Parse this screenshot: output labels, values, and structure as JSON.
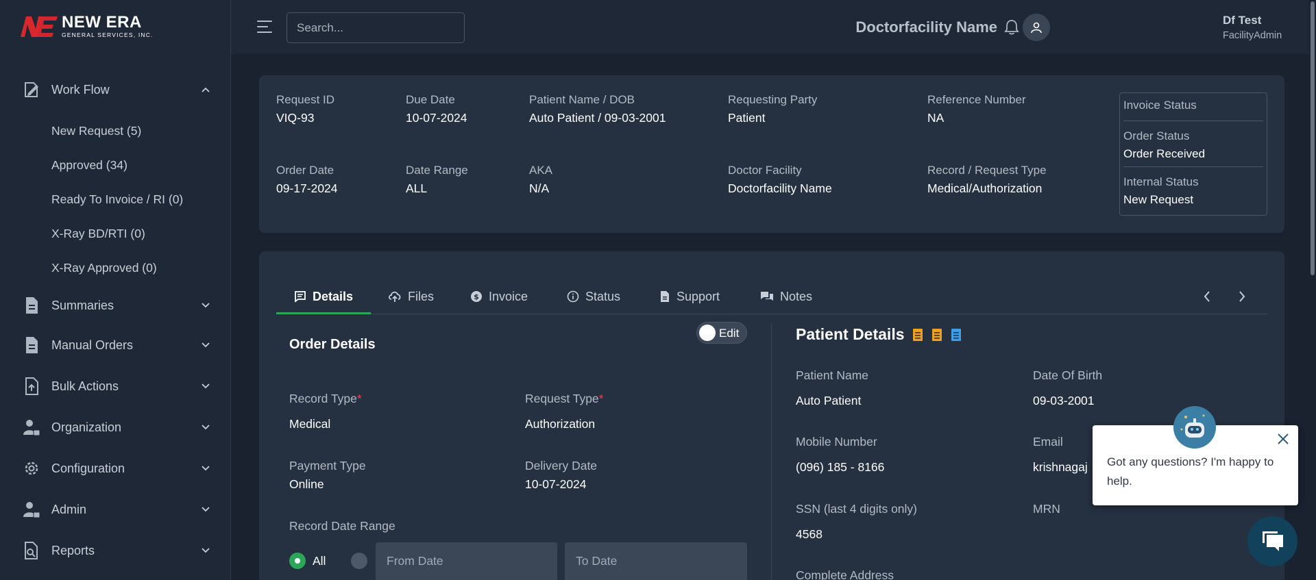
{
  "brand": {
    "mark": "NE",
    "title": "NEW ERA",
    "subtitle": "GENERAL SERVICES, INC."
  },
  "sidebar": {
    "groups": [
      {
        "label": "Work Flow",
        "icon": "workflow-icon",
        "expanded": true,
        "items": [
          "New Request (5)",
          "Approved (34)",
          "Ready To Invoice / RI (0)",
          "X-Ray BD/RTI (0)",
          "X-Ray Approved (0)"
        ]
      },
      {
        "label": "Summaries",
        "icon": "document-icon",
        "expanded": false
      },
      {
        "label": "Manual Orders",
        "icon": "document-icon",
        "expanded": false
      },
      {
        "label": "Bulk Actions",
        "icon": "upload-file-icon",
        "expanded": false
      },
      {
        "label": "Organization",
        "icon": "user-lock-icon",
        "expanded": false
      },
      {
        "label": "Configuration",
        "icon": "gear-icon",
        "expanded": false
      },
      {
        "label": "Admin",
        "icon": "user-lock-icon",
        "expanded": false
      },
      {
        "label": "Reports",
        "icon": "report-search-icon",
        "expanded": false
      }
    ]
  },
  "topbar": {
    "search_placeholder": "Search...",
    "facility_name": "Doctorfacility Name",
    "user_name": "Df Test",
    "user_role": "FacilityAdmin"
  },
  "request_info": {
    "request_id": {
      "label": "Request ID",
      "value": "VIQ-93"
    },
    "due_date": {
      "label": "Due Date",
      "value": "10-07-2024"
    },
    "patient": {
      "label": "Patient Name / DOB",
      "value": "Auto Patient / 09-03-2001"
    },
    "requesting_party": {
      "label": "Requesting Party",
      "value": "Patient"
    },
    "reference_number": {
      "label": "Reference Number",
      "value": "NA"
    },
    "order_date": {
      "label": "Order Date",
      "value": "09-17-2024"
    },
    "date_range": {
      "label": "Date Range",
      "value": "ALL"
    },
    "aka": {
      "label": "AKA",
      "value": "N/A"
    },
    "doctor_facility": {
      "label": "Doctor Facility",
      "value": "Doctorfacility Name"
    },
    "record_request_type": {
      "label": "Record / Request Type",
      "value": "Medical/Authorization"
    },
    "status_box": {
      "invoice_status_label": "Invoice Status",
      "order_status_label": "Order Status",
      "order_status_value": "Order Received",
      "internal_status_label": "Internal Status",
      "internal_status_value": "New Request"
    }
  },
  "tabs": [
    {
      "label": "Details",
      "icon": "message-square-icon",
      "active": true
    },
    {
      "label": "Files",
      "icon": "cloud-upload-icon",
      "active": false
    },
    {
      "label": "Invoice",
      "icon": "dollar-circle-icon",
      "active": false
    },
    {
      "label": "Status",
      "icon": "info-circle-icon",
      "active": false
    },
    {
      "label": "Support",
      "icon": "file-icon",
      "active": false
    },
    {
      "label": "Notes",
      "icon": "chat-bubbles-icon",
      "active": false
    }
  ],
  "order_details": {
    "title": "Order Details",
    "edit_label": "Edit",
    "edit_enabled": false,
    "record_type_label": "Record Type",
    "record_type_value": "Medical",
    "request_type_label": "Request Type",
    "request_type_value": "Authorization",
    "required_mark": "*",
    "payment_type_label": "Payment Type",
    "payment_type_value": "Online",
    "delivery_date_label": "Delivery Date",
    "delivery_date_value": "10-07-2024",
    "record_date_range_label": "Record Date Range",
    "all_label": "All",
    "from_date_placeholder": "From Date",
    "to_date_placeholder": "To Date"
  },
  "patient_details": {
    "title": "Patient Details",
    "patient_name_label": "Patient Name",
    "patient_name_value": "Auto Patient",
    "dob_label": "Date Of Birth",
    "dob_value": "09-03-2001",
    "mobile_label": "Mobile Number",
    "mobile_value": "(096) 185 - 8166",
    "email_label": "Email",
    "email_value": "krishnagaj",
    "ssn_label": "SSN (last 4 digits only)",
    "ssn_value": "4568",
    "mrn_label": "MRN",
    "address_label": "Complete Address"
  },
  "chat": {
    "message": "Got any questions? I'm happy to help."
  },
  "colors": {
    "accent_green": "#2ea65a",
    "doc_orange": "#f0a020",
    "doc_blue": "#3aa0e8",
    "required_red": "#e04848"
  }
}
